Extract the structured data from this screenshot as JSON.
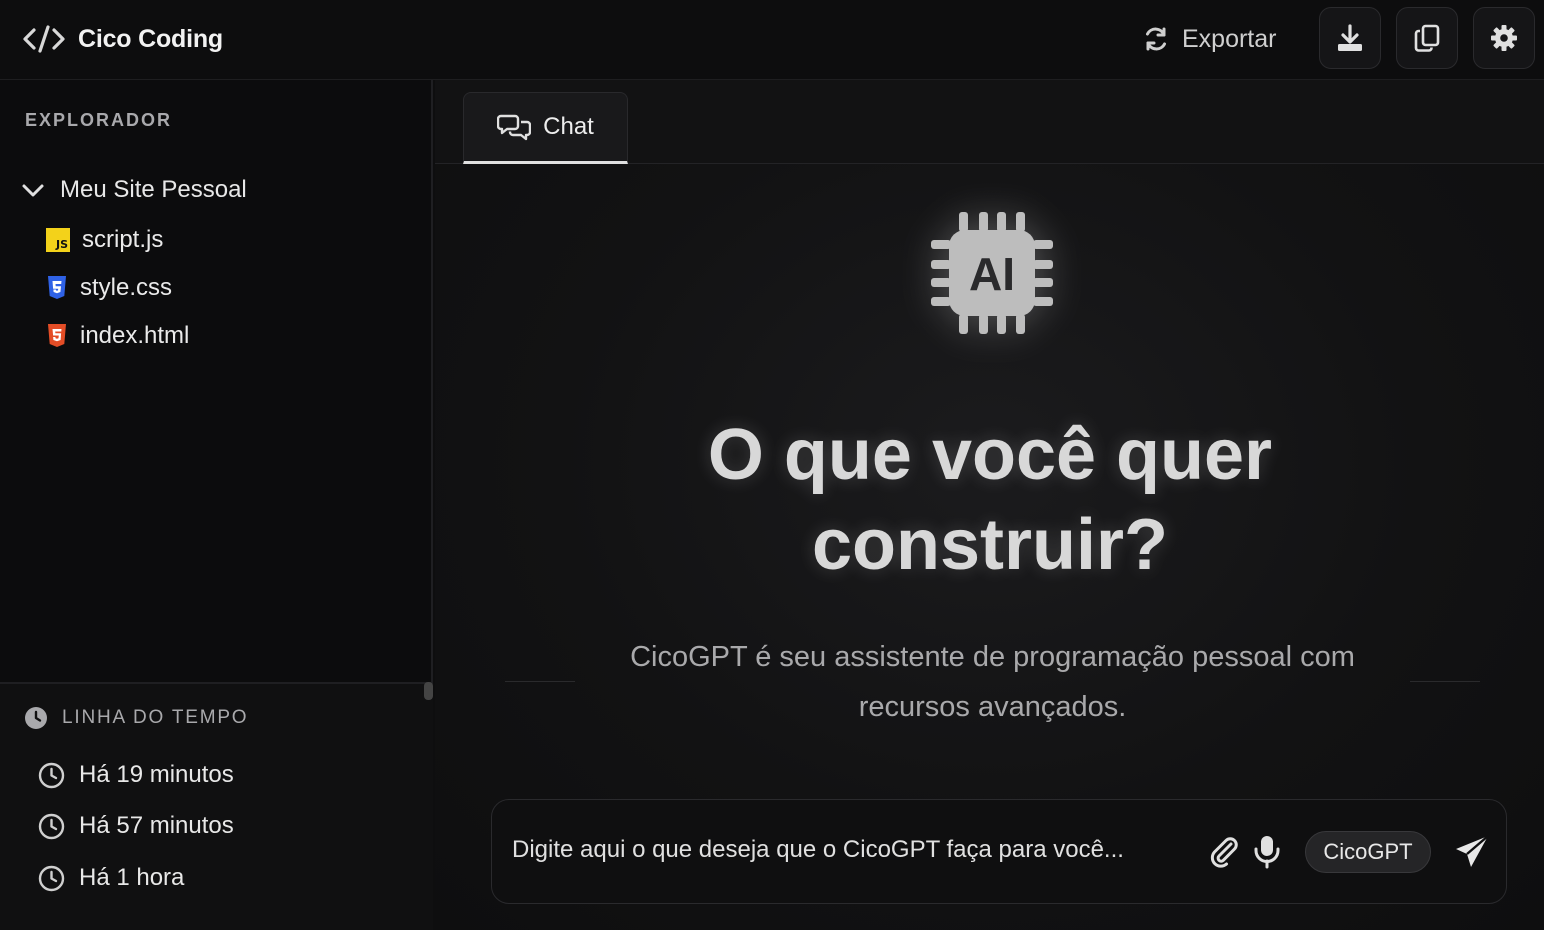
{
  "header": {
    "brand": "Cico Coding",
    "brand_icon": "code-icon",
    "export_label": "Exportar",
    "export_icon": "refresh-icon",
    "actions": [
      "download-icon",
      "copy-icon",
      "gear-icon"
    ]
  },
  "sidebar": {
    "explorer_title": "EXPLORADOR",
    "folder": {
      "label": "Meu Site Pessoal",
      "icon": "chevron-down-icon",
      "expanded": true
    },
    "files": [
      {
        "name": "script.js",
        "icon": "javascript-file-icon",
        "color": "#f3d21a"
      },
      {
        "name": "style.css",
        "icon": "css-file-icon",
        "color": "#2f62e6"
      },
      {
        "name": "index.html",
        "icon": "html-file-icon",
        "color": "#e44d26"
      }
    ],
    "timeline": {
      "title": "LINHA DO TEMPO",
      "items": [
        {
          "label": "Há 19 minutos"
        },
        {
          "label": "Há 57 minutos"
        },
        {
          "label": "Há 1 hora"
        }
      ]
    }
  },
  "main": {
    "tabs": [
      {
        "label": "Chat",
        "icon": "chat-bubbles-icon",
        "active": true
      }
    ],
    "hero": {
      "icon_label": "AI",
      "title": "O que você quer construir?",
      "subtitle": "CicoGPT é seu assistente de programação pessoal com recursos avançados."
    },
    "composer": {
      "placeholder": "Digite aqui o que deseja que o CicoGPT faça para você...",
      "value": "",
      "model": "CicoGPT"
    }
  },
  "colors": {
    "background": "#0e0e0f",
    "text": "#e8e8e8",
    "muted": "#a9a9ac",
    "js": "#f3d21a",
    "css": "#2f62e6",
    "html": "#e44d26"
  }
}
